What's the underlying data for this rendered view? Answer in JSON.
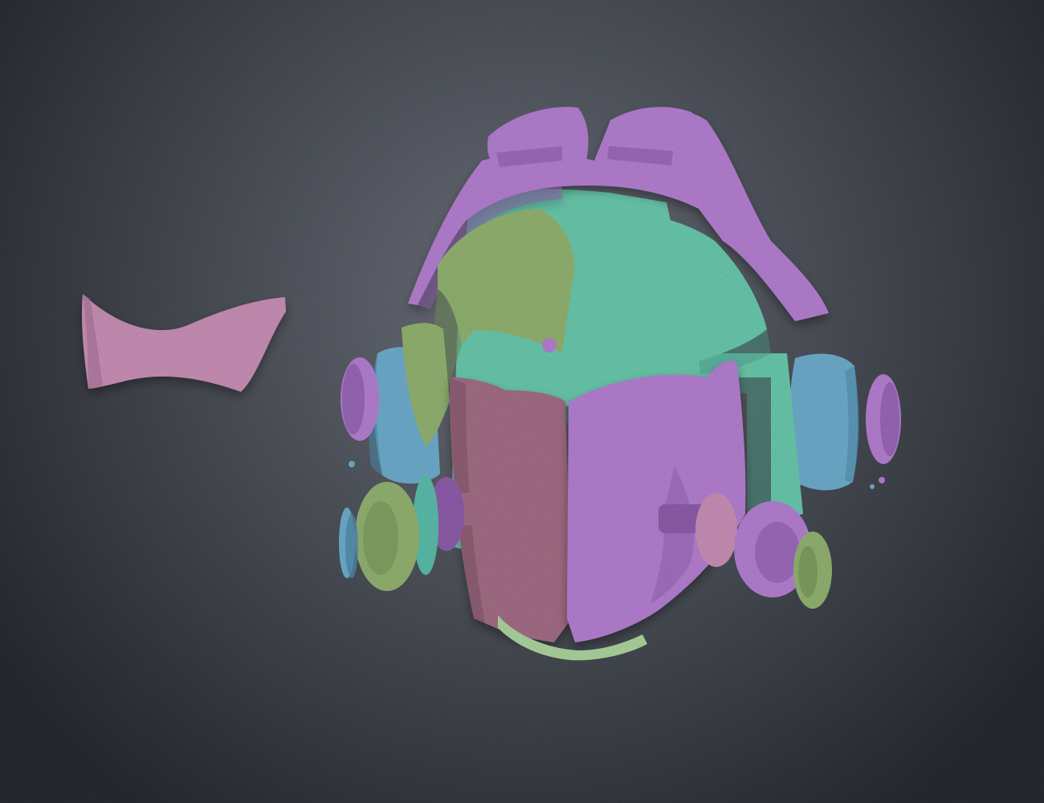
{
  "scene": {
    "subject": "exploded-helmet-render",
    "background": {
      "center_color": "#6a6e78",
      "edge_color": "#25292f"
    },
    "part_colors": {
      "violet": "#b07ccc",
      "violet_shade": "#8a5aa6",
      "mint": "#66c4a8",
      "mint_shade": "#4a9c86",
      "olive_green": "#8fae6e",
      "olive_shade": "#6e8c52",
      "sky_blue": "#6ba8c8",
      "sky_shade": "#4d86a6",
      "dusty_rose": "#9e6a82",
      "rose_shade": "#7c4e64",
      "pale_green": "#a8cf9a",
      "pale_pink": "#c48cb2",
      "pale_pink_shade": "#a06a92",
      "cyan_green": "#58b8a6"
    },
    "parts": [
      {
        "name": "detached-visor-band",
        "color": "pale_pink"
      },
      {
        "name": "crown-crest-left",
        "color": "violet"
      },
      {
        "name": "crown-crest-right",
        "color": "violet"
      },
      {
        "name": "crown-shell",
        "color": "violet"
      },
      {
        "name": "brow-plate-left",
        "color": "olive_green"
      },
      {
        "name": "brow-plate-right",
        "color": "mint"
      },
      {
        "name": "inner-frame",
        "color": "mint"
      },
      {
        "name": "ear-pad-left",
        "color": "sky_blue"
      },
      {
        "name": "ear-pad-right",
        "color": "sky_blue"
      },
      {
        "name": "skull-mask-left",
        "color": "dusty_rose"
      },
      {
        "name": "skull-mask-right",
        "color": "violet"
      },
      {
        "name": "rebreather-canister-left",
        "color": "olive_green"
      },
      {
        "name": "rebreather-canister-right",
        "color": "violet"
      },
      {
        "name": "chin-strap",
        "color": "pale_green"
      },
      {
        "name": "side-disc-left",
        "color": "violet"
      },
      {
        "name": "side-disc-right",
        "color": "violet"
      },
      {
        "name": "end-cap-right",
        "color": "olive_green"
      },
      {
        "name": "washers-left",
        "color": "sky_blue"
      }
    ]
  }
}
